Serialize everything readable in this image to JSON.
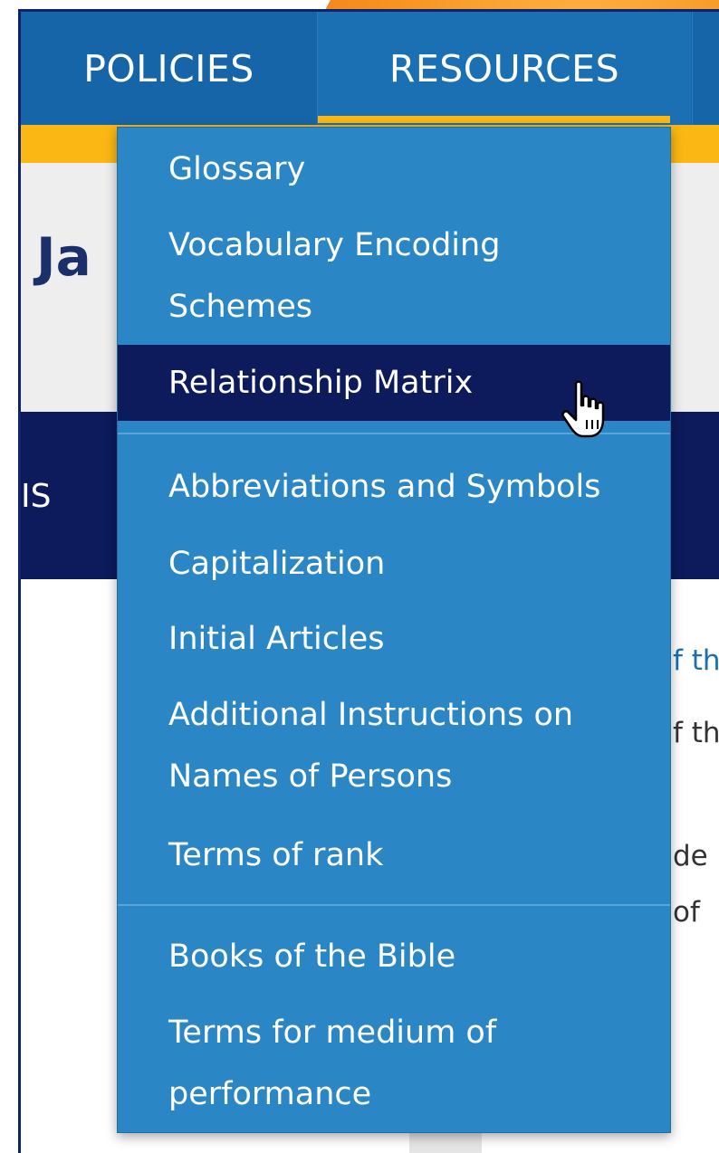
{
  "nav": {
    "items": [
      {
        "label": "POLICIES"
      },
      {
        "label": "RESOURCES",
        "active": true
      }
    ]
  },
  "page": {
    "title_fragment": "Ja",
    "subnav_fragment": "IS",
    "body_fragments": [
      "f th",
      "f th",
      "de",
      "of"
    ]
  },
  "dropdown": {
    "groups": [
      [
        "Glossary",
        "Vocabulary Encoding Schemes",
        "Relationship Matrix"
      ],
      [
        "Abbreviations and Symbols",
        "Capitalization",
        "Initial Articles",
        "Additional Instructions on Names of Persons",
        "Terms of rank"
      ],
      [
        "Books of the Bible",
        "Terms for medium of performance"
      ]
    ],
    "items": {
      "glossary": "Glossary",
      "vocab_line1": "Vocabulary Encoding",
      "vocab_line2": "Schemes",
      "relationship_matrix": "Relationship Matrix",
      "abbreviations": "Abbreviations and Symbols",
      "capitalization": "Capitalization",
      "initial_articles": "Initial Articles",
      "additional_line1": "Additional Instructions on",
      "additional_line2": "Names of Persons",
      "terms_rank": "Terms of rank",
      "books_bible": "Books of the Bible",
      "medium_line1": "Terms for medium of",
      "medium_line2": "performance"
    },
    "hovered_item": "Relationship Matrix"
  },
  "colors": {
    "nav_bg": "#1565a8",
    "accent_yellow": "#fbb714",
    "dropdown_bg": "#2b86c5",
    "active_bg": "#0d1a5c",
    "title_color": "#1b2f6b"
  },
  "icons": [
    "hand-pointer-cursor-icon"
  ]
}
